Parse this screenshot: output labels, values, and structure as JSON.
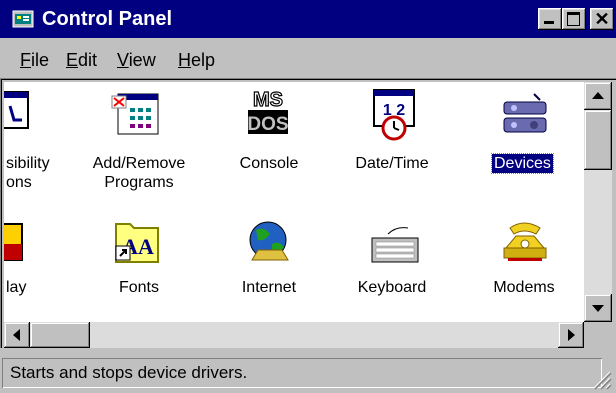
{
  "window": {
    "title": "Control Panel",
    "title_icon": "control-panel-icon",
    "controls": [
      "minimize",
      "maximize",
      "close"
    ],
    "close_glyph": "✕"
  },
  "menu": [
    {
      "first": "F",
      "rest": "ile"
    },
    {
      "first": "E",
      "rest": "dit"
    },
    {
      "first": "V",
      "rest": "iew"
    },
    {
      "first": "H",
      "rest": "elp"
    }
  ],
  "icons": [
    {
      "lines": [
        "sibility",
        "ons"
      ],
      "icon": "accessibility-icon",
      "selected": false
    },
    {
      "lines": [
        "Add/Remove",
        "Programs"
      ],
      "icon": "add-remove-programs-icon",
      "selected": false
    },
    {
      "lines": [
        "Console"
      ],
      "icon": "console-icon",
      "selected": false
    },
    {
      "lines": [
        "Date/Time"
      ],
      "icon": "date-time-icon",
      "selected": false
    },
    {
      "lines": [
        "Devices"
      ],
      "icon": "devices-icon",
      "selected": true
    },
    {
      "lines": [
        "lay"
      ],
      "icon": "display-icon",
      "selected": false
    },
    {
      "lines": [
        "Fonts"
      ],
      "icon": "fonts-icon",
      "selected": false
    },
    {
      "lines": [
        "Internet"
      ],
      "icon": "internet-icon",
      "selected": false
    },
    {
      "lines": [
        "Keyboard"
      ],
      "icon": "keyboard-icon",
      "selected": false
    },
    {
      "lines": [
        "Modems"
      ],
      "icon": "modems-icon",
      "selected": false
    }
  ],
  "console_icon_text": [
    "MS",
    "DOS"
  ],
  "date_icon_text": "1 2",
  "fonts_icon_text": "AA",
  "status": {
    "text": "Starts and stops device drivers."
  },
  "colors": {
    "title_bar": "#000080",
    "face": "#c0c0c0",
    "selection": "#000080",
    "view_background": "#ffffff"
  }
}
